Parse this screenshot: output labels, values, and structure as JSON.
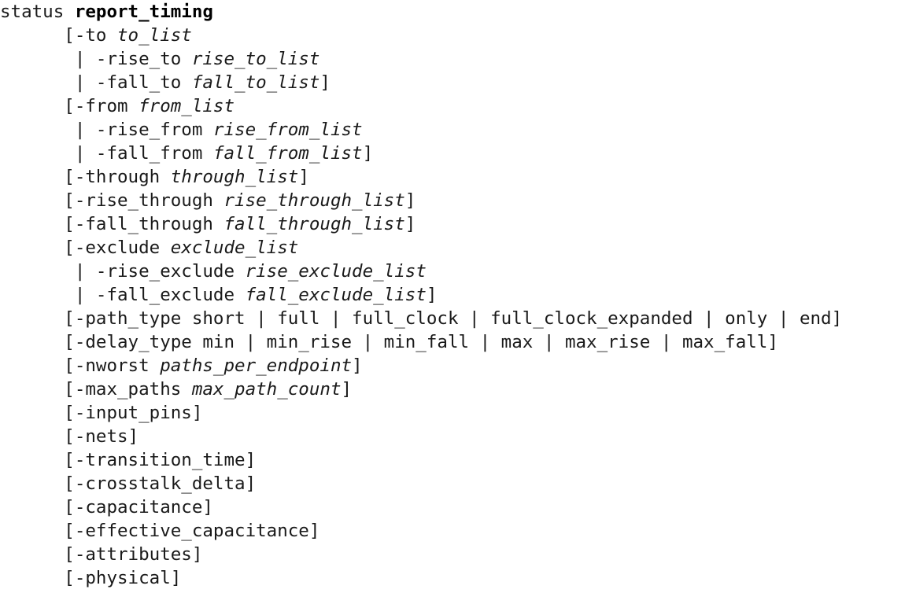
{
  "document": {
    "kind": "command-syntax-reference",
    "command_prefix": "status",
    "command_name": "report_timing",
    "indent_option": "      ",
    "indent_alternative": "       ",
    "lines": [
      {
        "id": "header",
        "type": "header",
        "indent": "",
        "segments": [
          {
            "style": "plain",
            "text": "status "
          },
          {
            "style": "command",
            "text": "report_timing"
          }
        ]
      },
      {
        "id": "opt-to",
        "type": "option",
        "indent": "      ",
        "segments": [
          {
            "style": "plain",
            "text": "[-to "
          },
          {
            "style": "arg",
            "text": "to_list"
          }
        ]
      },
      {
        "id": "alt-rise-to",
        "type": "alternative",
        "indent": "       ",
        "segments": [
          {
            "style": "plain",
            "text": "| -rise_to "
          },
          {
            "style": "arg",
            "text": "rise_to_list"
          }
        ]
      },
      {
        "id": "alt-fall-to",
        "type": "alternative",
        "indent": "       ",
        "segments": [
          {
            "style": "plain",
            "text": "| -fall_to "
          },
          {
            "style": "arg",
            "text": "fall_to_list"
          },
          {
            "style": "plain",
            "text": "]"
          }
        ]
      },
      {
        "id": "opt-from",
        "type": "option",
        "indent": "      ",
        "segments": [
          {
            "style": "plain",
            "text": "[-from "
          },
          {
            "style": "arg",
            "text": "from_list"
          }
        ]
      },
      {
        "id": "alt-rise-from",
        "type": "alternative",
        "indent": "       ",
        "segments": [
          {
            "style": "plain",
            "text": "| -rise_from "
          },
          {
            "style": "arg",
            "text": "rise_from_list"
          }
        ]
      },
      {
        "id": "alt-fall-from",
        "type": "alternative",
        "indent": "       ",
        "segments": [
          {
            "style": "plain",
            "text": "| -fall_from "
          },
          {
            "style": "arg",
            "text": "fall_from_list"
          },
          {
            "style": "plain",
            "text": "]"
          }
        ]
      },
      {
        "id": "opt-through",
        "type": "option",
        "indent": "      ",
        "segments": [
          {
            "style": "plain",
            "text": "[-through "
          },
          {
            "style": "arg",
            "text": "through_list"
          },
          {
            "style": "plain",
            "text": "]"
          }
        ]
      },
      {
        "id": "opt-rise-through",
        "type": "option",
        "indent": "      ",
        "segments": [
          {
            "style": "plain",
            "text": "[-rise_through "
          },
          {
            "style": "arg",
            "text": "rise_through_list"
          },
          {
            "style": "plain",
            "text": "]"
          }
        ]
      },
      {
        "id": "opt-fall-through",
        "type": "option",
        "indent": "      ",
        "segments": [
          {
            "style": "plain",
            "text": "[-fall_through "
          },
          {
            "style": "arg",
            "text": "fall_through_list"
          },
          {
            "style": "plain",
            "text": "]"
          }
        ]
      },
      {
        "id": "opt-exclude",
        "type": "option",
        "indent": "      ",
        "segments": [
          {
            "style": "plain",
            "text": "[-exclude "
          },
          {
            "style": "arg",
            "text": "exclude_list"
          }
        ]
      },
      {
        "id": "alt-rise-exclude",
        "type": "alternative",
        "indent": "       ",
        "segments": [
          {
            "style": "plain",
            "text": "| -rise_exclude "
          },
          {
            "style": "arg",
            "text": "rise_exclude_list"
          }
        ]
      },
      {
        "id": "alt-fall-exclude",
        "type": "alternative",
        "indent": "       ",
        "segments": [
          {
            "style": "plain",
            "text": "| -fall_exclude "
          },
          {
            "style": "arg",
            "text": "fall_exclude_list"
          },
          {
            "style": "plain",
            "text": "]"
          }
        ]
      },
      {
        "id": "opt-path-type",
        "type": "option",
        "indent": "      ",
        "segments": [
          {
            "style": "plain",
            "text": "[-path_type short | full | full_clock | full_clock_expanded | only | end]"
          }
        ]
      },
      {
        "id": "opt-delay-type",
        "type": "option",
        "indent": "      ",
        "segments": [
          {
            "style": "plain",
            "text": "[-delay_type min | min_rise | min_fall | max | max_rise | max_fall]"
          }
        ]
      },
      {
        "id": "opt-nworst",
        "type": "option",
        "indent": "      ",
        "segments": [
          {
            "style": "plain",
            "text": "[-nworst "
          },
          {
            "style": "arg",
            "text": "paths_per_endpoint"
          },
          {
            "style": "plain",
            "text": "]"
          }
        ]
      },
      {
        "id": "opt-max-paths",
        "type": "option",
        "indent": "      ",
        "segments": [
          {
            "style": "plain",
            "text": "[-max_paths "
          },
          {
            "style": "arg",
            "text": "max_path_count"
          },
          {
            "style": "plain",
            "text": "]"
          }
        ]
      },
      {
        "id": "opt-input-pins",
        "type": "option",
        "indent": "      ",
        "segments": [
          {
            "style": "plain",
            "text": "[-input_pins]"
          }
        ]
      },
      {
        "id": "opt-nets",
        "type": "option",
        "indent": "      ",
        "segments": [
          {
            "style": "plain",
            "text": "[-nets]"
          }
        ]
      },
      {
        "id": "opt-transition-time",
        "type": "option",
        "indent": "      ",
        "segments": [
          {
            "style": "plain",
            "text": "[-transition_time]"
          }
        ]
      },
      {
        "id": "opt-crosstalk-delta",
        "type": "option",
        "indent": "      ",
        "segments": [
          {
            "style": "plain",
            "text": "[-crosstalk_delta]"
          }
        ]
      },
      {
        "id": "opt-capacitance",
        "type": "option",
        "indent": "      ",
        "segments": [
          {
            "style": "plain",
            "text": "[-capacitance]"
          }
        ]
      },
      {
        "id": "opt-effective-capacitance",
        "type": "option",
        "indent": "      ",
        "segments": [
          {
            "style": "plain",
            "text": "[-effective_capacitance]"
          }
        ]
      },
      {
        "id": "opt-attributes",
        "type": "option",
        "indent": "      ",
        "segments": [
          {
            "style": "plain",
            "text": "[-attributes]"
          }
        ]
      },
      {
        "id": "opt-physical",
        "type": "option",
        "indent": "      ",
        "segments": [
          {
            "style": "plain",
            "text": "[-physical]"
          }
        ]
      }
    ]
  },
  "colors": {
    "background": "#ffffff",
    "text": "#1a1a1a",
    "command": "#000000"
  }
}
